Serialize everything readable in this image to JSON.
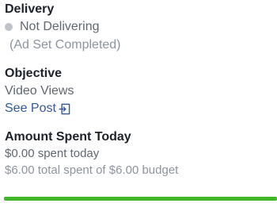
{
  "delivery": {
    "heading": "Delivery",
    "status": "Not Delivering",
    "sub_status": "(Ad Set Completed)",
    "status_dot_color": "#bec3c9",
    "status_dot_icon": "status-dot-icon"
  },
  "objective": {
    "heading": "Objective",
    "value": "Video Views",
    "link_label": "See Post",
    "link_icon": "open-in-icon"
  },
  "amount_spent": {
    "heading": "Amount Spent Today",
    "spent_today": "$0.00 spent today",
    "budget_text": "$6.00 total spent of $6.00 budget",
    "budget_progress": 1.0,
    "progress_color": "#42b72a"
  }
}
